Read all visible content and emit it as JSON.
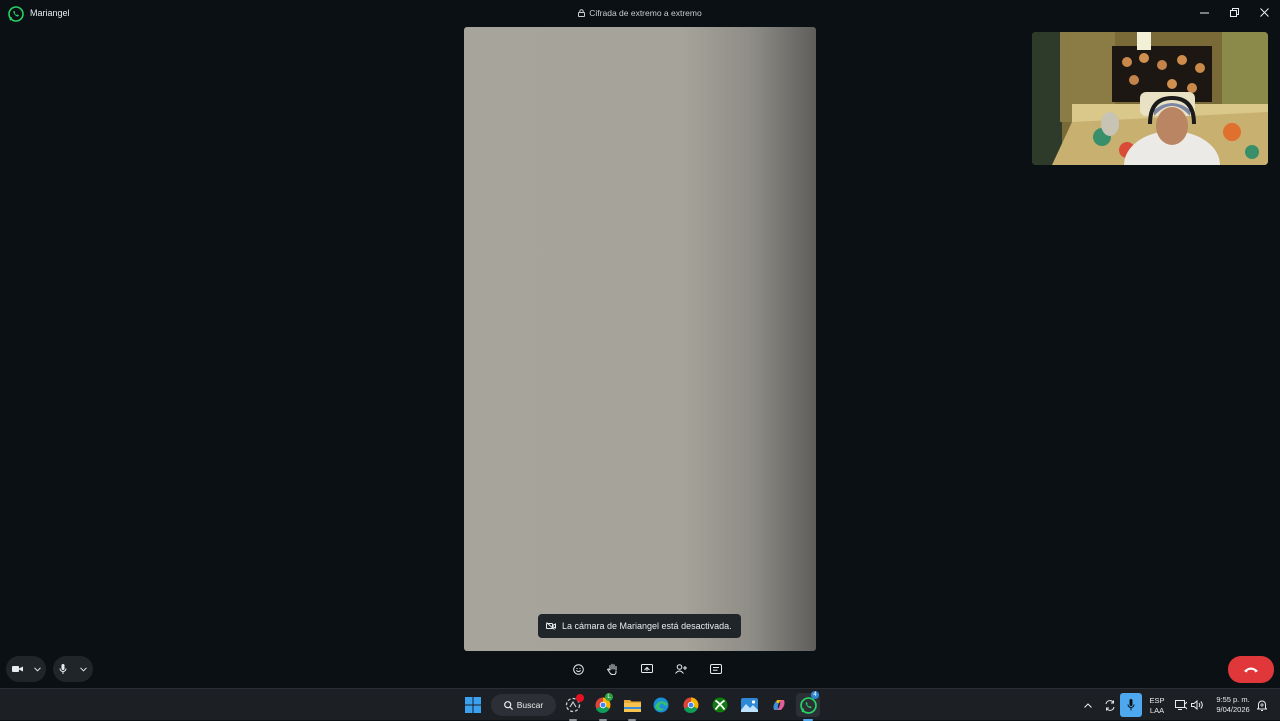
{
  "window": {
    "contact_name": "Mariangel",
    "encryption_label": "Cifrada de extremo a extremo"
  },
  "toast": {
    "text": "La cámara de Mariangel está desactivada."
  },
  "call_controls": {
    "left": [
      "video-camera-icon",
      "chevron-down-icon",
      "microphone-icon",
      "chevron-down-icon"
    ],
    "center": [
      "emoji-icon",
      "raise-hand-icon",
      "screen-share-icon",
      "add-person-icon",
      "chat-icon"
    ],
    "end_call": "phone-hangup-icon"
  },
  "taskbar": {
    "search_label": "Buscar",
    "pinned_icons": [
      "windows-start-icon",
      "search-icon",
      "badge-app-icon",
      "chrome-profile-icon",
      "file-explorer-icon",
      "edge-icon",
      "chrome-icon",
      "xbox-icon",
      "photos-icon",
      "copilot-icon",
      "whatsapp-icon"
    ],
    "whatsapp_badge": "4",
    "chrome_badge": "L"
  },
  "tray": {
    "language": "ESP",
    "layout": "LAA",
    "time": "9:55 p. m.",
    "date": "9/04/2026"
  },
  "colors": {
    "background": "#0b1014",
    "end_call": "#e0383a",
    "whatsapp_green": "#25d366",
    "taskbar": "#1c1f24"
  }
}
